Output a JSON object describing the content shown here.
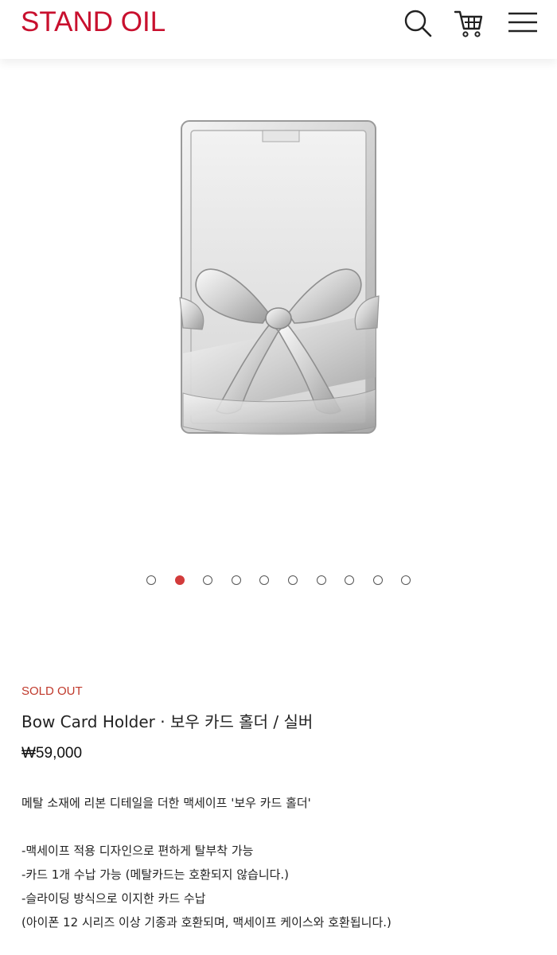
{
  "header": {
    "logo": "STAND OIL",
    "icons": [
      "search-icon",
      "cart-icon",
      "menu-icon"
    ]
  },
  "gallery": {
    "slide_count": 10,
    "active_index": 1
  },
  "product": {
    "status": "SOLD OUT",
    "name": "Bow Card Holder · 보우 카드 홀더 / 실버",
    "price": "₩59,000",
    "description": {
      "intro": "메탈 소재에 리본 디테일을 더한 맥세이프 '보우 카드 홀더'",
      "features": [
        "-맥세이프 적용 디자인으로 편하게 탈부착 가능",
        "-카드 1개 수납 가능 (메탈카드는 호환되지 않습니다.)",
        "-슬라이딩 방식으로 이지한 카드 수납",
        "(아이폰 12 시리즈 이상 기종과 호환되며, 맥세이프 케이스와 호환됩니다.)"
      ]
    }
  },
  "colors": {
    "brand": "#c8102e",
    "sold_out": "#c0392b",
    "active_dot": "#d23b3b"
  }
}
